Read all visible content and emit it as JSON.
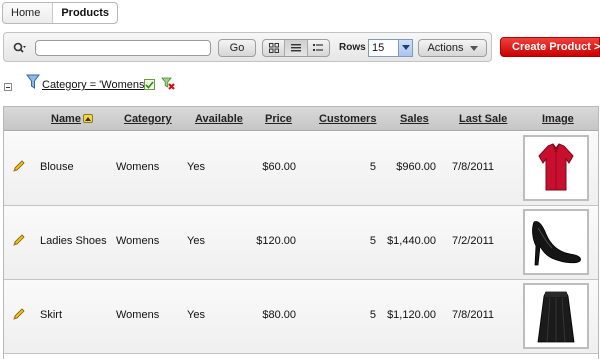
{
  "breadcrumb": {
    "home": "Home",
    "current": "Products"
  },
  "toolbar": {
    "search_value": "",
    "go_label": "Go",
    "rows_label": "Rows",
    "rows_value": "15",
    "actions_label": "Actions"
  },
  "create_button": "Create Product >",
  "filter": {
    "text": "Category = 'Womens'"
  },
  "columns": {
    "name": "Name",
    "category": "Category",
    "available": "Available",
    "price": "Price",
    "customers": "Customers",
    "sales": "Sales",
    "last_sale": "Last Sale",
    "image": "Image"
  },
  "rows": [
    {
      "name": "Blouse",
      "category": "Womens",
      "available": "Yes",
      "price": "$60.00",
      "customers": "5",
      "sales": "$960.00",
      "last_sale": "7/8/2011",
      "image": "blouse-image"
    },
    {
      "name": "Ladies Shoes",
      "category": "Womens",
      "available": "Yes",
      "price": "$120.00",
      "customers": "5",
      "sales": "$1,440.00",
      "last_sale": "7/2/2011",
      "image": "shoe-image"
    },
    {
      "name": "Skirt",
      "category": "Womens",
      "available": "Yes",
      "price": "$80.00",
      "customers": "5",
      "sales": "$1,120.00",
      "last_sale": "7/8/2011",
      "image": "skirt-image"
    }
  ],
  "colors": {
    "accent_red": "#cc0000",
    "header_gray": "#d0d0d0"
  }
}
